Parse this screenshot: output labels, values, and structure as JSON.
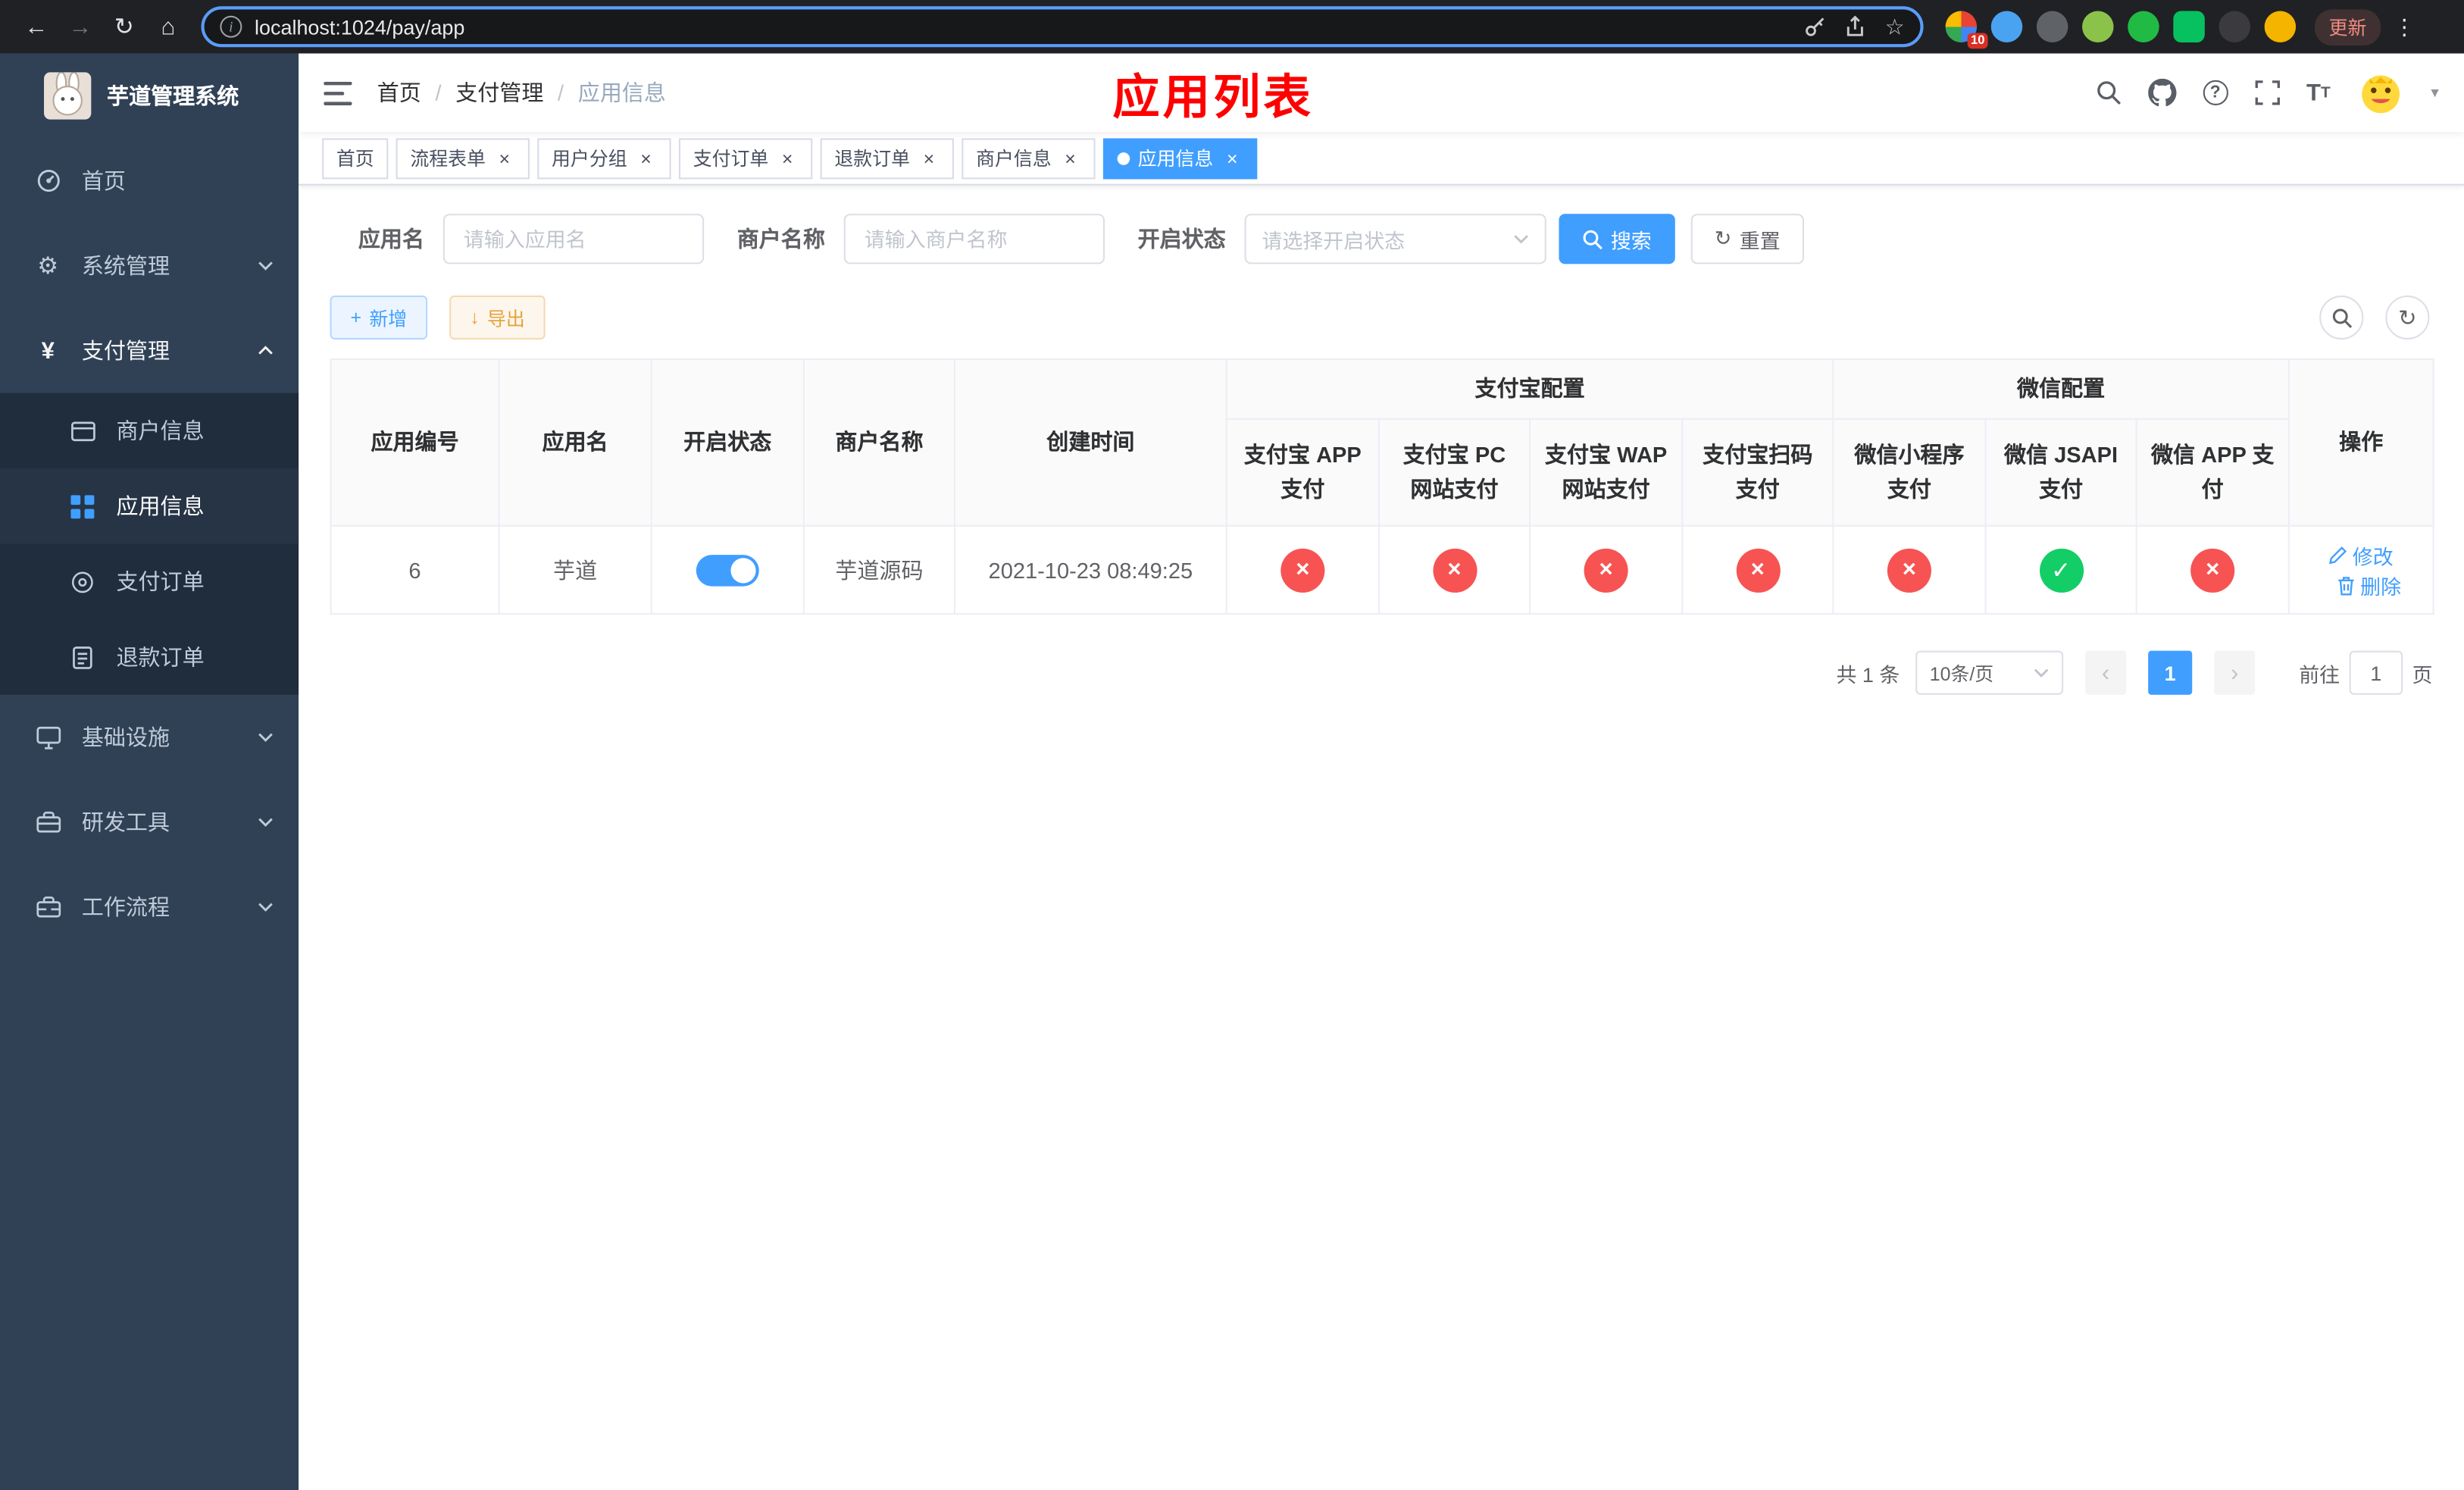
{
  "browser": {
    "url": "localhost:1024/pay/app",
    "update_label": "更新",
    "extension_badge": "10"
  },
  "sidebar": {
    "title": "芋道管理系统",
    "items": [
      {
        "label": "首页"
      },
      {
        "label": "系统管理"
      },
      {
        "label": "支付管理"
      },
      {
        "label": "商户信息"
      },
      {
        "label": "应用信息"
      },
      {
        "label": "支付订单"
      },
      {
        "label": "退款订单"
      },
      {
        "label": "基础设施"
      },
      {
        "label": "研发工具"
      },
      {
        "label": "工作流程"
      }
    ]
  },
  "navbar": {
    "breadcrumb": [
      "首页",
      "支付管理",
      "应用信息"
    ],
    "separator": "/",
    "annotation": "应用列表"
  },
  "tabs": [
    {
      "label": "首页"
    },
    {
      "label": "流程表单"
    },
    {
      "label": "用户分组"
    },
    {
      "label": "支付订单"
    },
    {
      "label": "退款订单"
    },
    {
      "label": "商户信息"
    },
    {
      "label": "应用信息"
    }
  ],
  "filters": {
    "app_name_label": "应用名",
    "app_name_placeholder": "请输入应用名",
    "merchant_name_label": "商户名称",
    "merchant_name_placeholder": "请输入商户名称",
    "status_label": "开启状态",
    "status_placeholder": "请选择开启状态",
    "search_label": "搜索",
    "reset_label": "重置"
  },
  "toolbar": {
    "add_label": "新增",
    "export_label": "导出"
  },
  "table": {
    "group_headers": {
      "alipay": "支付宝配置",
      "wechat": "微信配置"
    },
    "headers": {
      "app_id": "应用编号",
      "app_name": "应用名",
      "status": "开启状态",
      "merchant_name": "商户名称",
      "create_time": "创建时间",
      "alipay_app": "支付宝 APP 支付",
      "alipay_pc": "支付宝 PC 网站支付",
      "alipay_wap": "支付宝 WAP 网站支付",
      "alipay_qr": "支付宝扫码支付",
      "wechat_lite": "微信小程序支付",
      "wechat_jsapi": "微信 JSAPI 支付",
      "wechat_app": "微信 APP 支付",
      "actions": "操作"
    },
    "rows": [
      {
        "app_id": "6",
        "app_name": "芋道",
        "status": "on",
        "merchant_name": "芋道源码",
        "create_time": "2021-10-23 08:49:25",
        "alipay_app": "off",
        "alipay_pc": "off",
        "alipay_wap": "off",
        "alipay_qr": "off",
        "wechat_lite": "off",
        "wechat_jsapi": "on",
        "wechat_app": "off"
      }
    ],
    "edit_label": "修改",
    "delete_label": "删除"
  },
  "pagination": {
    "total_text": "共 1 条",
    "page_size": "10条/页",
    "current_page": "1",
    "goto_label": "前往",
    "goto_value": "1",
    "page_label": "页"
  },
  "icons": {
    "back": "←",
    "forward": "→",
    "reload": "↻",
    "home": "⌂",
    "info": "i",
    "star": "☆",
    "menu_dots": "⋮",
    "caret_down": "▾",
    "help": "?",
    "t_large": "T",
    "t_small": "T",
    "gear": "⚙",
    "yen": "¥",
    "plus": "+",
    "download": "↓",
    "refresh": "↻",
    "check": "✓",
    "cross": "×",
    "close": "×",
    "prev": "‹",
    "next": "›"
  },
  "colors": {
    "primary": "#409eff",
    "success": "#13ce66",
    "danger": "#f75353",
    "warning": "#e6a23c",
    "sidebar_bg": "#304156",
    "submenu_bg": "#1f2d3d",
    "annotation": "#ff0000"
  }
}
